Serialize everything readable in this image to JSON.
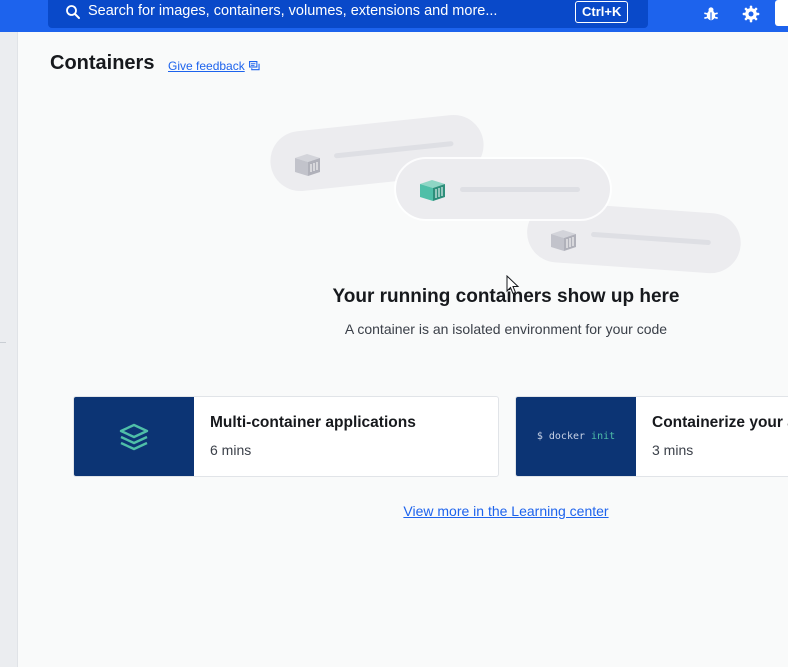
{
  "topbar": {
    "search_placeholder": "Search for images, containers, volumes, extensions and more...",
    "shortcut": "Ctrl+K",
    "icons": [
      "search-icon",
      "bug-icon",
      "gear-icon"
    ]
  },
  "page": {
    "title": "Containers",
    "feedback_label": "Give feedback"
  },
  "empty_state": {
    "title": "Your running containers show up here",
    "subtitle": "A container is an isolated environment for your code"
  },
  "cards": [
    {
      "title": "Multi-container applications",
      "duration": "6 mins",
      "icon": "stack-icon"
    },
    {
      "title": "Containerize your application",
      "duration": "3 mins",
      "code_prompt": "$ docker",
      "code_cmd": "init"
    }
  ],
  "learning_link": "View more in the Learning center",
  "colors": {
    "accent": "#1d63ed",
    "search_bg": "#0949c9",
    "card_thumb": "#0c3474",
    "teal": "#4fbfa8"
  }
}
